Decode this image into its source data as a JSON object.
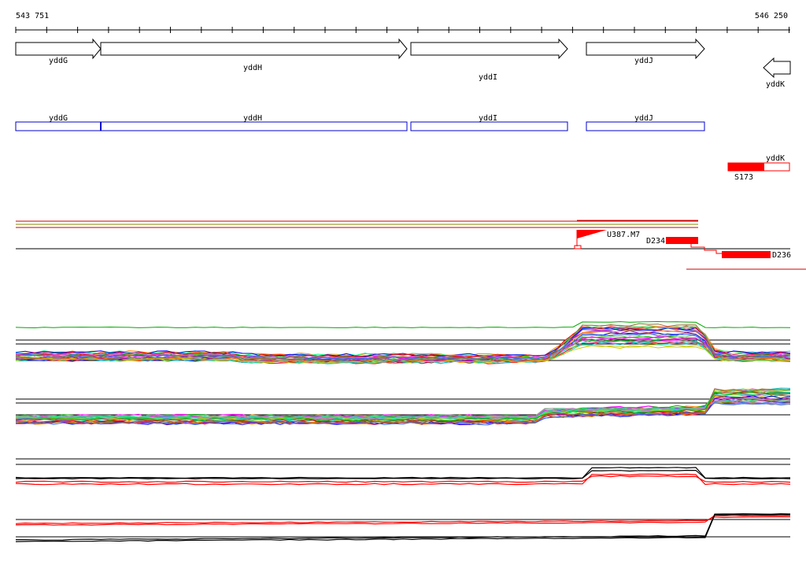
{
  "coordinates": {
    "start": "543 751",
    "end": "546 250"
  },
  "genes": [
    {
      "name": "yddG",
      "strand": "+"
    },
    {
      "name": "yddH",
      "strand": "+"
    },
    {
      "name": "yddI",
      "strand": "+"
    },
    {
      "name": "yddJ",
      "strand": "+"
    },
    {
      "name": "yddK",
      "strand": "-"
    }
  ],
  "annotations": [
    {
      "name": "yddG"
    },
    {
      "name": "yddH"
    },
    {
      "name": "yddI"
    },
    {
      "name": "yddJ"
    }
  ],
  "features": {
    "yddK_label": "yddK",
    "s173": "S173",
    "u387": "U387.M7",
    "d234": "D234",
    "d236": "D236"
  },
  "colors": {
    "gene_outline": "#000000",
    "annotation_box": "#0000cc",
    "feature_fill": "#ff0000",
    "axis": "#000000"
  }
}
